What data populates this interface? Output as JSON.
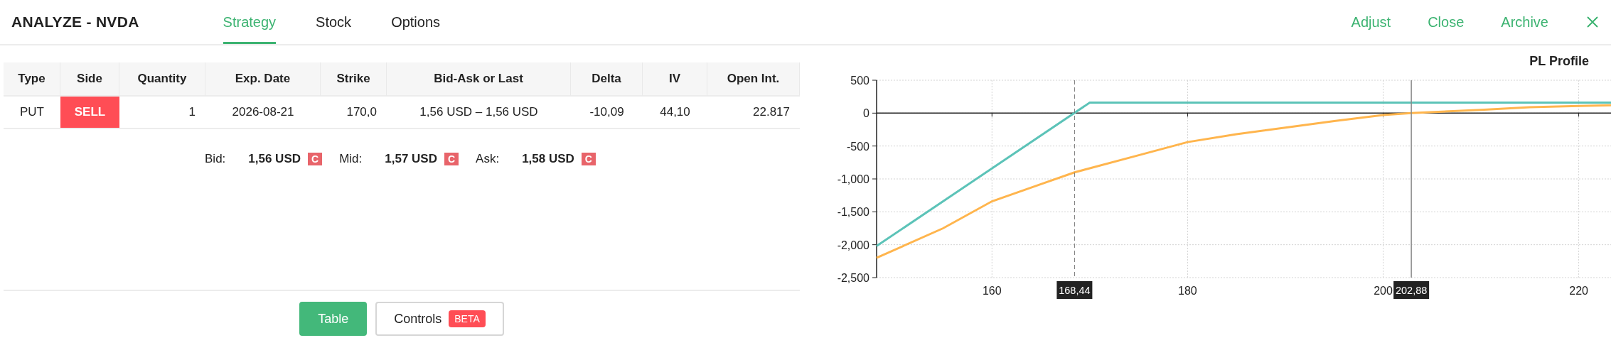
{
  "header": {
    "title": "ANALYZE - NVDA",
    "tabs": [
      {
        "label": "Strategy",
        "selected": true
      },
      {
        "label": "Stock",
        "selected": false
      },
      {
        "label": "Options",
        "selected": false
      }
    ],
    "actions": [
      {
        "label": "Adjust"
      },
      {
        "label": "Close"
      },
      {
        "label": "Archive"
      }
    ]
  },
  "table": {
    "columns": [
      "Type",
      "Side",
      "Quantity",
      "Exp. Date",
      "Strike",
      "Bid-Ask or Last",
      "Delta",
      "IV",
      "Open Int."
    ],
    "rows": [
      {
        "cells": [
          {
            "text": "PUT",
            "highlight": false
          },
          {
            "text": "SELL",
            "highlight": true
          },
          {
            "text": "1",
            "highlight": false
          },
          {
            "text": "2026-08-21",
            "highlight": false
          },
          {
            "text": "170,0",
            "highlight": false
          },
          {
            "text": "1,56 USD – 1,56 USD",
            "highlight": false
          },
          {
            "text": "-10,09",
            "highlight": false
          },
          {
            "text": "44,10",
            "highlight": false
          },
          {
            "text": "22.817",
            "highlight": false
          }
        ]
      }
    ]
  },
  "quotes": [
    {
      "label": "Bid:",
      "value": "1,56 USD",
      "badge": "C"
    },
    {
      "label": "Mid:",
      "value": "1,57 USD",
      "badge": "C"
    },
    {
      "label": "Ask:",
      "value": "1,58 USD",
      "badge": "C"
    }
  ],
  "view_toggle": [
    {
      "label": "Table",
      "selected": true
    },
    {
      "label": "Controls",
      "selected": false,
      "badge": "BETA"
    }
  ],
  "chart": {
    "chart_data": {
      "type": "line",
      "title": "PL Profile",
      "xlim": [
        148.2,
        223.3
      ],
      "ylim": [
        -2500,
        500
      ],
      "grid": true,
      "xticks": [
        160,
        180,
        200,
        220
      ],
      "yticks": [
        {
          "value": 500,
          "label": "500"
        },
        {
          "value": 0,
          "label": "0"
        },
        {
          "value": -500,
          "label": "-500"
        },
        {
          "value": -1000,
          "label": "-1,000"
        },
        {
          "value": -1500,
          "label": "-1,500"
        },
        {
          "value": -2000,
          "label": "-2,000"
        },
        {
          "value": -2500,
          "label": "-2,500"
        }
      ],
      "series": [
        {
          "color": "#5cc3b8",
          "x": [
            148.2,
            170,
            223.3
          ],
          "values": [
            -2020,
            160,
            160
          ]
        },
        {
          "color": "#ffb54d",
          "x": [
            148.2,
            155,
            160,
            165,
            168.44,
            175,
            180,
            185,
            190,
            195,
            200,
            202.88,
            210,
            215,
            220,
            223.3
          ],
          "values": [
            -2200,
            -1750,
            -1340,
            -1080,
            -900,
            -640,
            -440,
            -320,
            -220,
            -120,
            -30,
            0,
            50,
            90,
            110,
            120
          ]
        }
      ],
      "annotations": [
        {
          "x": 168.44,
          "text": "168,44"
        },
        {
          "x": 202.88,
          "text": "202,88"
        }
      ]
    }
  }
}
